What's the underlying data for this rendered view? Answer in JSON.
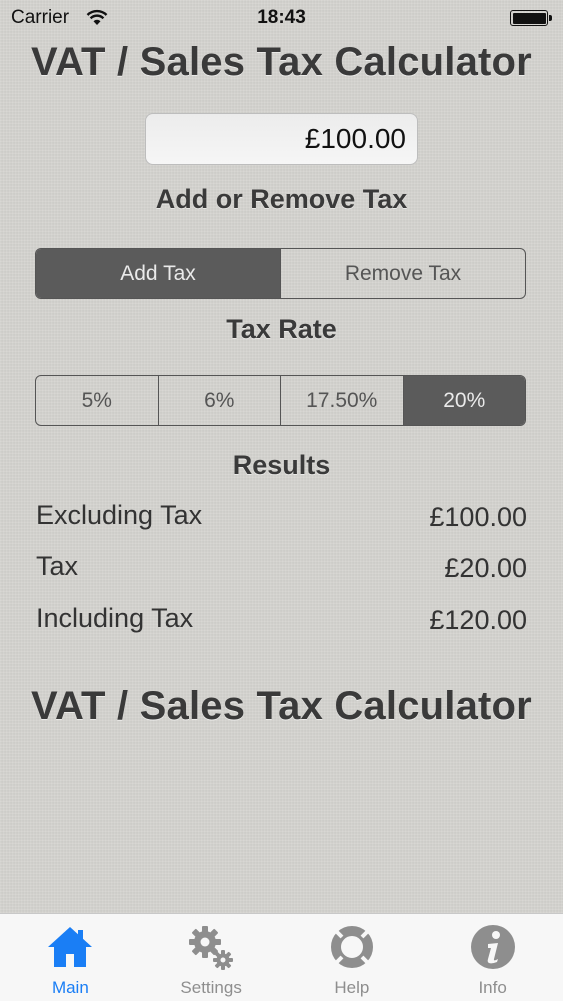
{
  "status_bar": {
    "carrier": "Carrier",
    "time": "18:43"
  },
  "header": {
    "title": "VAT / Sales Tax Calculator"
  },
  "amount": {
    "value": "£100.00"
  },
  "tax_mode": {
    "label": "Add or Remove Tax",
    "options": [
      {
        "label": "Add Tax",
        "selected": true
      },
      {
        "label": "Remove Tax",
        "selected": false
      }
    ]
  },
  "tax_rate": {
    "label": "Tax Rate",
    "options": [
      {
        "label": "5%",
        "selected": false
      },
      {
        "label": "6%",
        "selected": false
      },
      {
        "label": "17.50%",
        "selected": false
      },
      {
        "label": "20%",
        "selected": true
      }
    ]
  },
  "results": {
    "label": "Results",
    "rows": [
      {
        "label": "Excluding Tax",
        "value": "£100.00"
      },
      {
        "label": "Tax",
        "value": "£20.00"
      },
      {
        "label": "Including Tax",
        "value": "£120.00"
      }
    ]
  },
  "footer": {
    "title": "VAT / Sales Tax Calculator"
  },
  "tab_bar": {
    "items": [
      {
        "label": "Main",
        "icon": "house-icon",
        "active": true
      },
      {
        "label": "Settings",
        "icon": "gears-icon",
        "active": false
      },
      {
        "label": "Help",
        "icon": "lifebuoy-icon",
        "active": false
      },
      {
        "label": "Info",
        "icon": "info-icon",
        "active": false
      }
    ]
  },
  "colors": {
    "background": "#d4d3cf",
    "selected_segment": "#5b5b5b",
    "active_tab": "#1a7ef5",
    "inactive_tab": "#8e8e8e"
  }
}
